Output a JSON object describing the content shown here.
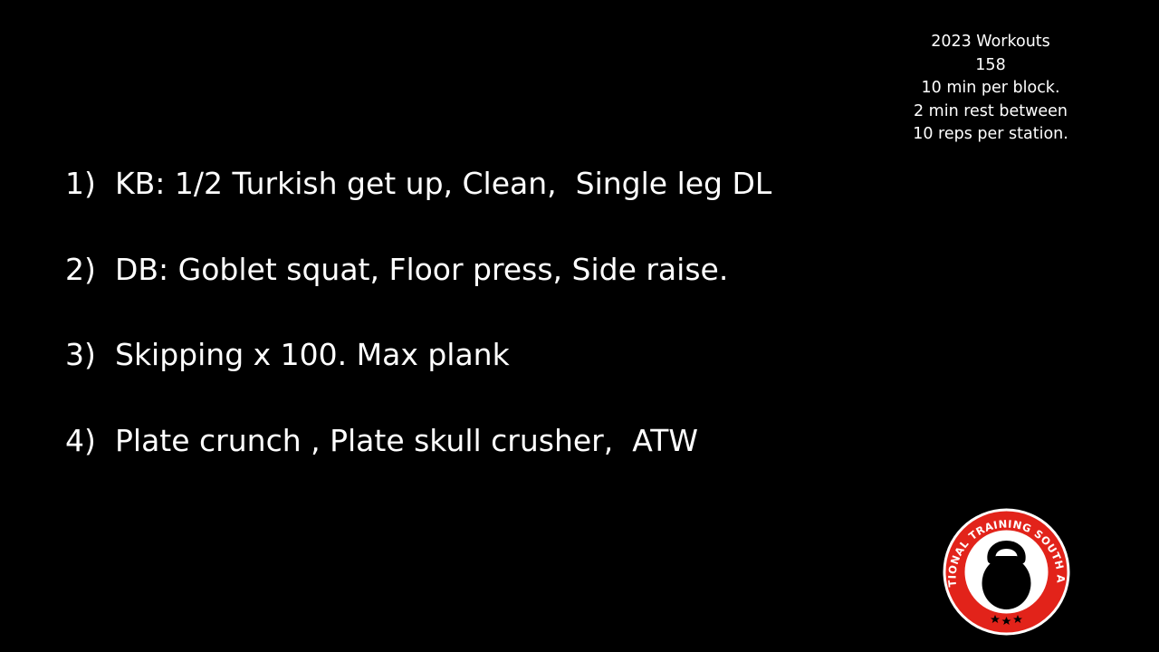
{
  "info": {
    "lines": [
      "2023 Workouts",
      "158",
      "10 min per block.",
      "2 min rest between",
      "10 reps per station."
    ]
  },
  "workouts": [
    {
      "number": "1)",
      "text": "KB: 1/2 Turkish get up, Clean,  Single leg DL"
    },
    {
      "number": "2)",
      "text": "DB: Goblet squat, Floor press, Side raise."
    },
    {
      "number": "3)",
      "text": "Skipping x 100. Max plank"
    },
    {
      "number": "4)",
      "text": "Plate crunch , Plate skull crusher,  ATW"
    }
  ],
  "logo": {
    "text": "FUNCTIONAL TRAINING SOUTH AFRICA",
    "icon": "kettlebell-icon",
    "colors": {
      "ring": "#e2231a",
      "inner": "#ffffff",
      "kettlebell": "#000000",
      "stars": "#000000"
    }
  },
  "colors": {
    "background": "#000000",
    "text": "#ffffff"
  }
}
